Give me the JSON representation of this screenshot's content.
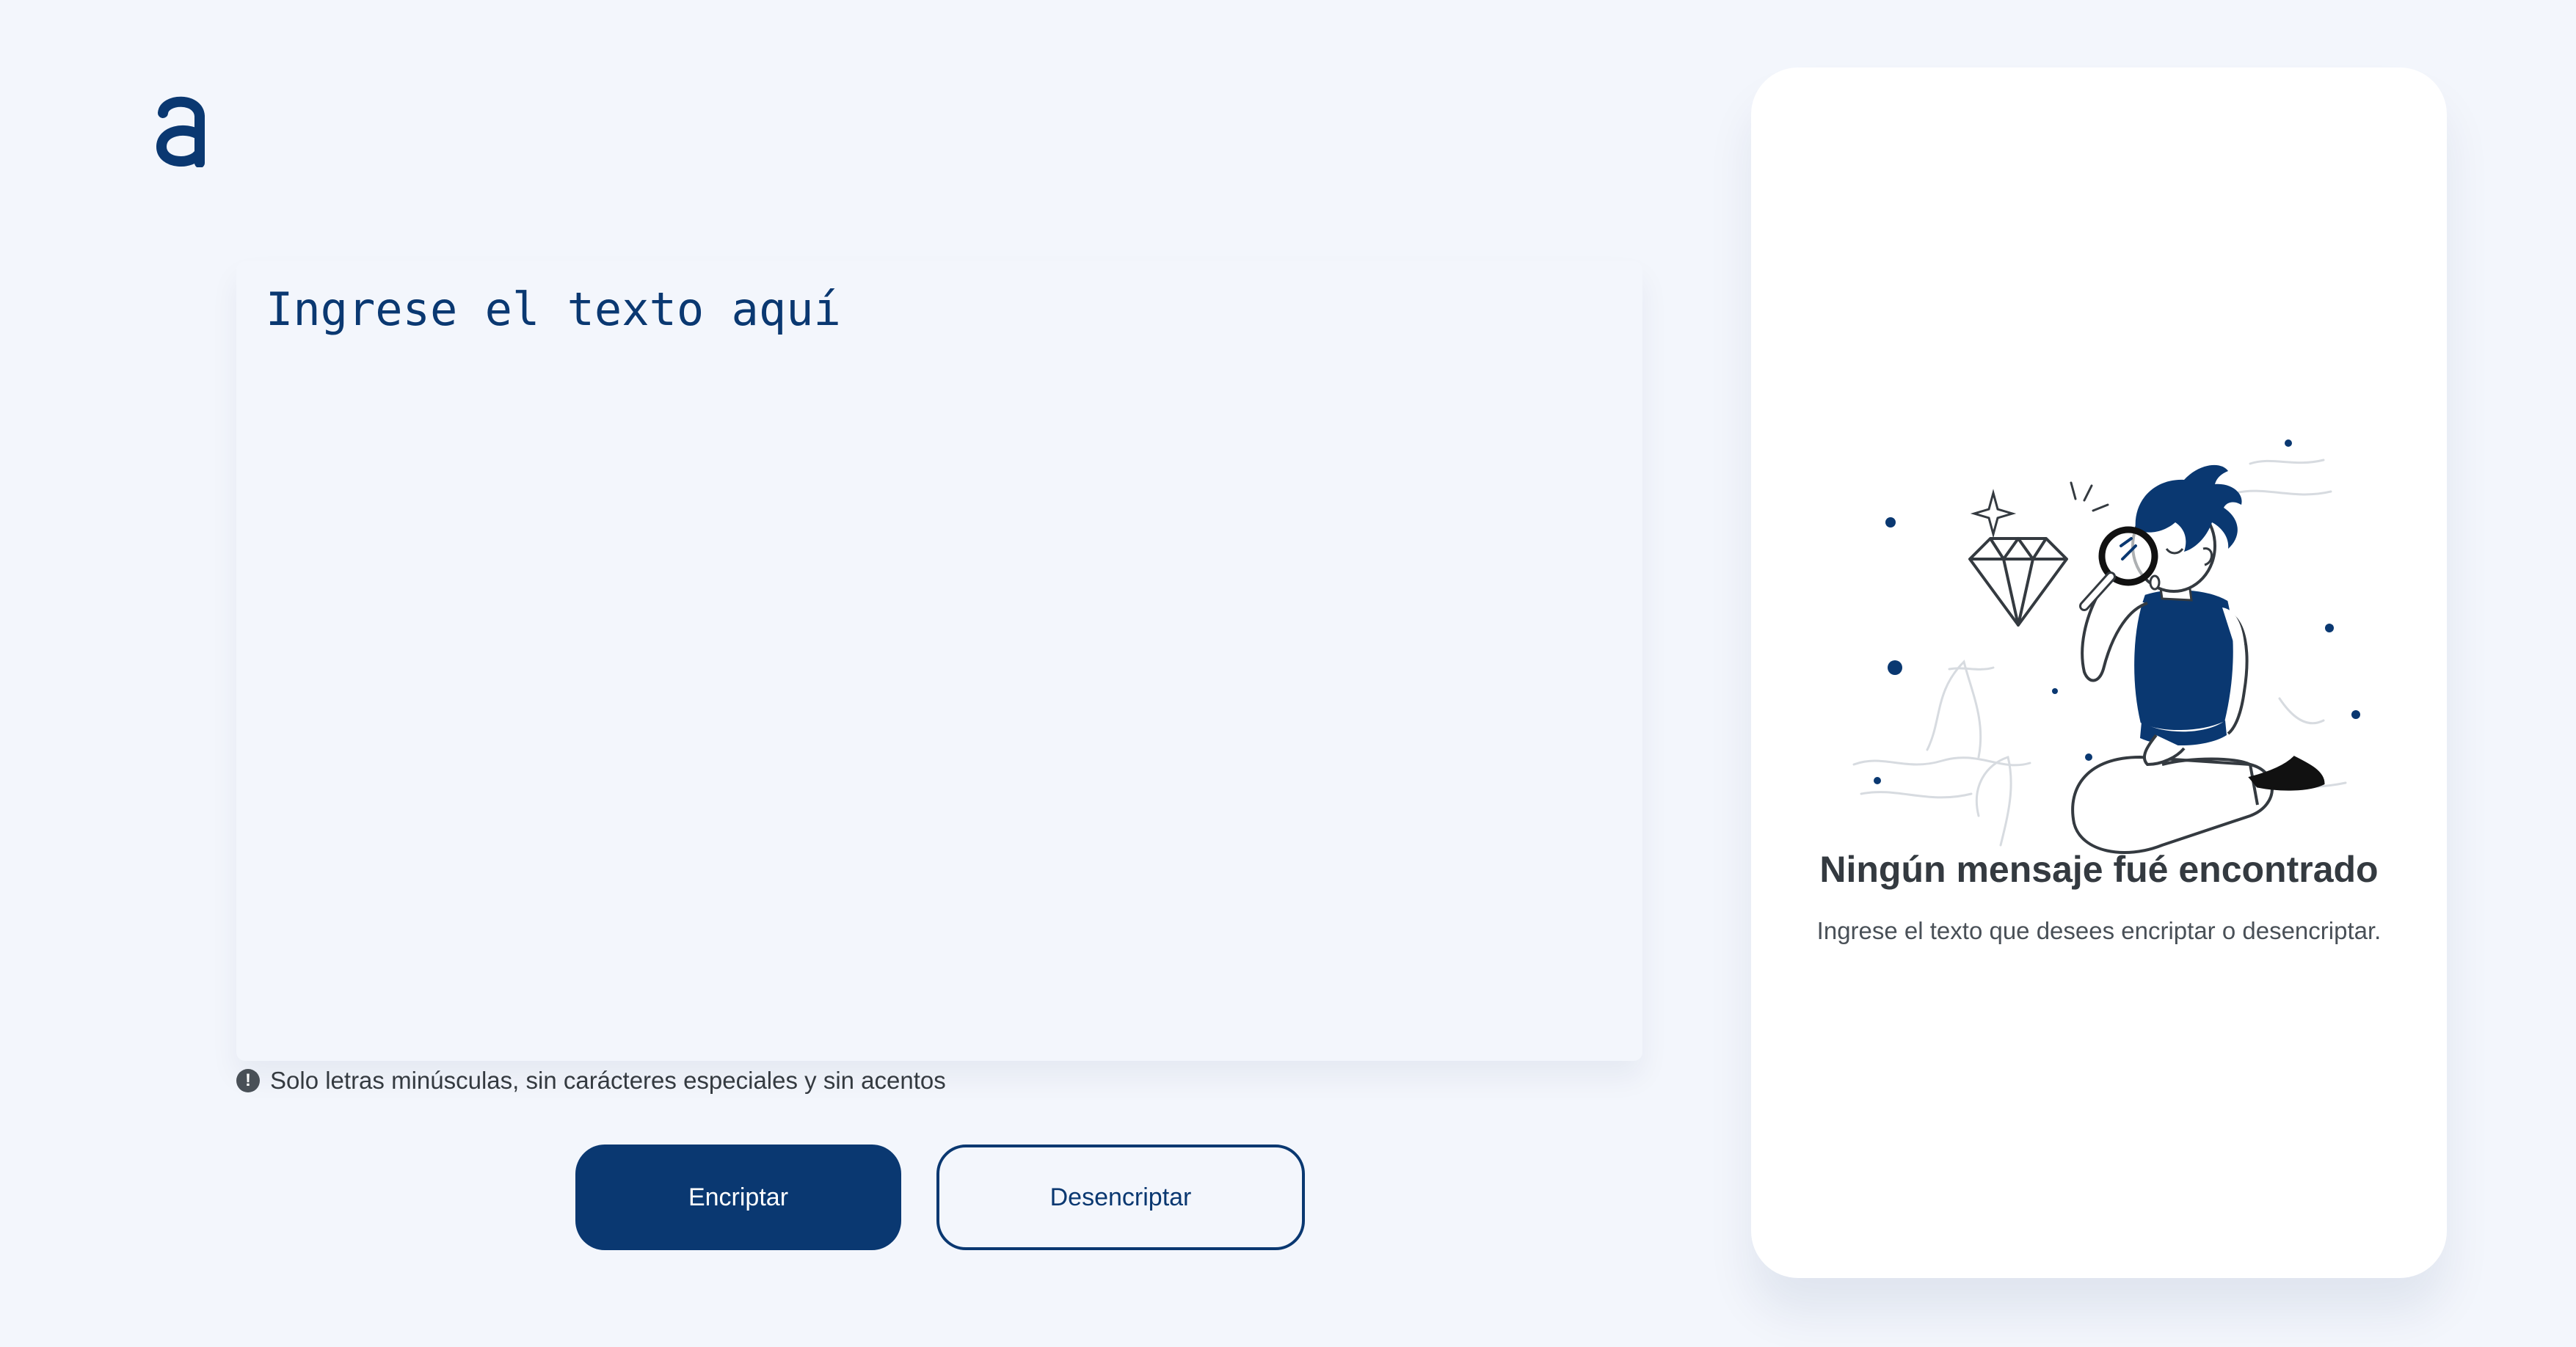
{
  "logo": {
    "icon": "alura-logo-icon",
    "color": "#0a3871"
  },
  "input": {
    "placeholder": "Ingrese el texto aquí",
    "value": ""
  },
  "hint": {
    "icon": "exclamation-circle-icon",
    "text": "Solo letras minúsculas, sin carácteres especiales y sin acentos"
  },
  "buttons": {
    "encrypt_label": "Encriptar",
    "decrypt_label": "Desencriptar"
  },
  "result": {
    "illustration": "person-with-magnifying-glass-illustration",
    "title": "Ningún mensaje fué encontrado",
    "subtitle": "Ingrese el texto que desees encriptar o desencriptar."
  },
  "colors": {
    "background": "#f3f6fc",
    "accent": "#0a3871",
    "card": "#ffffff",
    "text_dark": "#343a40"
  }
}
